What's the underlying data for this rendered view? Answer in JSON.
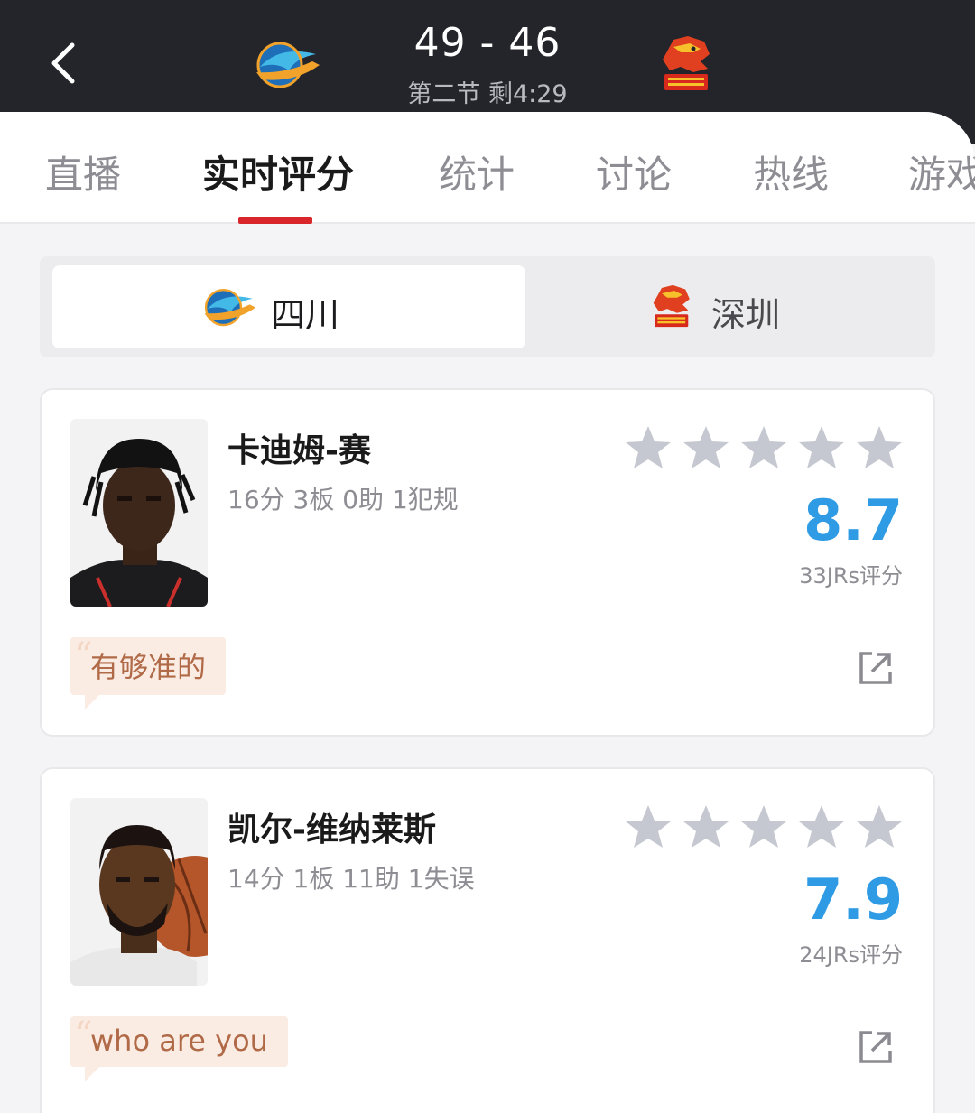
{
  "header": {
    "score": "49 - 46",
    "period": "第二节 剩4:29",
    "home_logo_icon": "sichuan-logo",
    "away_logo_icon": "shenzhen-leopards-logo"
  },
  "tabs": [
    {
      "label": "直播"
    },
    {
      "label": "实时评分",
      "active": true
    },
    {
      "label": "统计"
    },
    {
      "label": "讨论"
    },
    {
      "label": "热线"
    },
    {
      "label": "游戏"
    }
  ],
  "team_switch": {
    "home": {
      "name": "四川",
      "selected": true
    },
    "away": {
      "name": "深圳",
      "selected": false
    }
  },
  "players": [
    {
      "name": "卡迪姆-赛",
      "stats": "16分 3板 0助 1犯规",
      "rating": "8.7",
      "count": "33JRs评分",
      "comment": "有够准的"
    },
    {
      "name": "凯尔-维纳莱斯",
      "stats": "14分 1板 11助 1失误",
      "rating": "7.9",
      "count": "24JRs评分",
      "comment": "who are you"
    }
  ],
  "colors": {
    "header_bg": "#24252a",
    "accent_red": "#d8262b",
    "rating_blue": "#2f9be4",
    "comment_bg": "#fbece3",
    "comment_text": "#b06a48"
  }
}
